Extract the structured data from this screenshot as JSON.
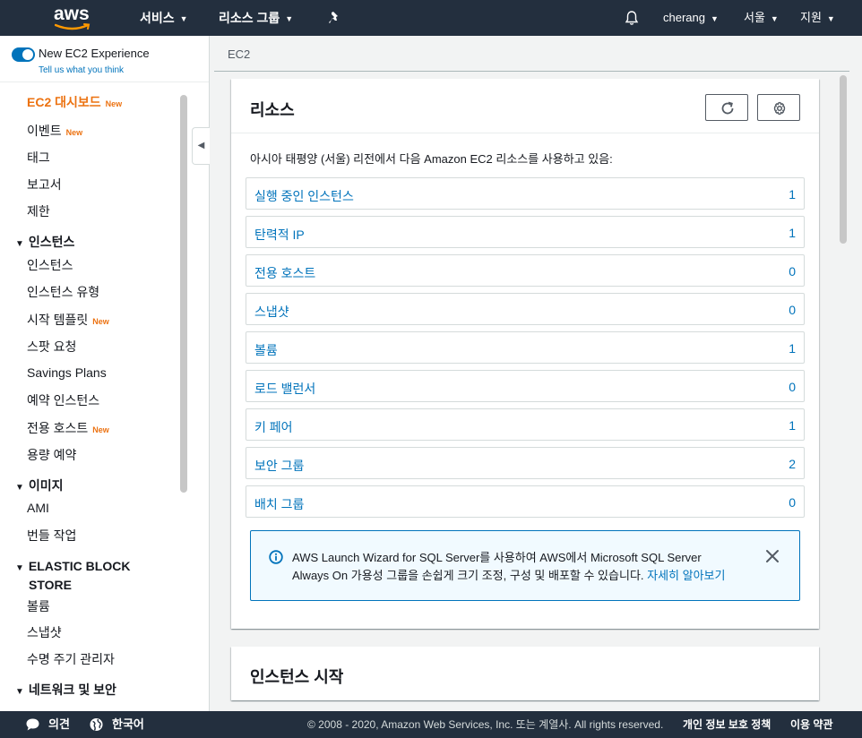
{
  "topnav": {
    "logo_text": "aws",
    "services": "서비스",
    "resource_groups": "리소스 그룹",
    "user": "cherang",
    "region": "서울",
    "support": "지원"
  },
  "sidebar": {
    "toggle_label": "New EC2 Experience",
    "toggle_sub": "Tell us what you think",
    "new_badge": "New",
    "items": [
      {
        "label": "EC2 대시보드",
        "new": true
      },
      {
        "label": "이벤트",
        "new": true
      },
      {
        "label": "태그"
      },
      {
        "label": "보고서"
      },
      {
        "label": "제한"
      }
    ],
    "sections": {
      "instances": {
        "title": "인스턴스",
        "items": [
          "인스턴스",
          "인스턴스 유형",
          "시작 템플릿",
          "스팟 요청",
          "Savings Plans",
          "예약 인스턴스",
          "전용 호스트",
          "용량 예약"
        ]
      },
      "images": {
        "title": "이미지",
        "items": [
          "AMI",
          "번들 작업"
        ]
      },
      "ebs": {
        "title_line1": "ELASTIC BLOCK",
        "title_line2": "STORE",
        "items": [
          "볼륨",
          "스냅샷",
          "수명 주기 관리자"
        ]
      },
      "network": {
        "title": "네트워크 및 보안"
      }
    }
  },
  "breadcrumb": "EC2",
  "resources": {
    "title": "리소스",
    "description": "아시아 태평양 (서울) 리전에서 다음 Amazon EC2 리소스를 사용하고 있음:",
    "rows": [
      {
        "label": "실행 중인 인스턴스",
        "count": "1"
      },
      {
        "label": "탄력적 IP",
        "count": "1"
      },
      {
        "label": "전용 호스트",
        "count": "0"
      },
      {
        "label": "스냅샷",
        "count": "0"
      },
      {
        "label": "볼륨",
        "count": "1"
      },
      {
        "label": "로드 밸런서",
        "count": "0"
      },
      {
        "label": "키 페어",
        "count": "1"
      },
      {
        "label": "보안 그룹",
        "count": "2"
      },
      {
        "label": "배치 그룹",
        "count": "0"
      }
    ],
    "alert": {
      "line1": "AWS Launch Wizard for SQL Server를 사용하여 AWS에서 Microsoft SQL Server",
      "line2": "Always On 가용성 그룹을 손쉽게 크기 조정, 구성 및 배포할 수 있습니다.",
      "link": "자세히 알아보기"
    }
  },
  "launch": {
    "title": "인스턴스 시작"
  },
  "footer": {
    "feedback": "의견",
    "language": "한국어",
    "copyright": "© 2008 - 2020, Amazon Web Services, Inc. 또는 계열사. All rights reserved.",
    "privacy": "개인 정보 보호 정책",
    "terms": "이용 약관"
  },
  "colors": {
    "nav_bg": "#232f3e",
    "accent_orange": "#ec7211",
    "link_blue": "#0073bb"
  }
}
